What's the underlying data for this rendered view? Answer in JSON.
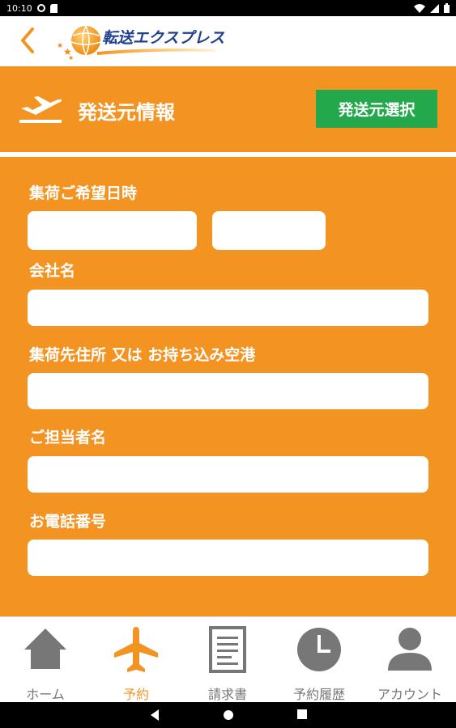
{
  "status_bar": {
    "time": "10:10"
  },
  "header": {
    "logo_text": "転送エクスプレス"
  },
  "section": {
    "title": "発送元情報",
    "select_button_label": "発送元選択"
  },
  "form": {
    "pickup_datetime_label": "集荷ご希望日時",
    "company_label": "会社名",
    "address_label": "集荷先住所 又は お持ち込み空港",
    "contact_label": "ご担当者名",
    "phone_label": "お電話番号",
    "pickup_date_value": "",
    "pickup_time_value": "",
    "company_value": "",
    "address_value": "",
    "contact_value": "",
    "phone_value": ""
  },
  "bottom_nav": {
    "items": [
      {
        "label": "ホーム",
        "icon": "home-icon",
        "active": false
      },
      {
        "label": "予約",
        "icon": "airplane-icon",
        "active": true
      },
      {
        "label": "請求書",
        "icon": "document-icon",
        "active": false
      },
      {
        "label": "予約履歴",
        "icon": "clock-icon",
        "active": false
      },
      {
        "label": "アカウント",
        "icon": "person-icon",
        "active": false
      }
    ]
  },
  "colors": {
    "primary_orange": "#f39422",
    "button_green": "#23a84b",
    "logo_blue": "#1f3f8f",
    "nav_gray": "#777777"
  }
}
